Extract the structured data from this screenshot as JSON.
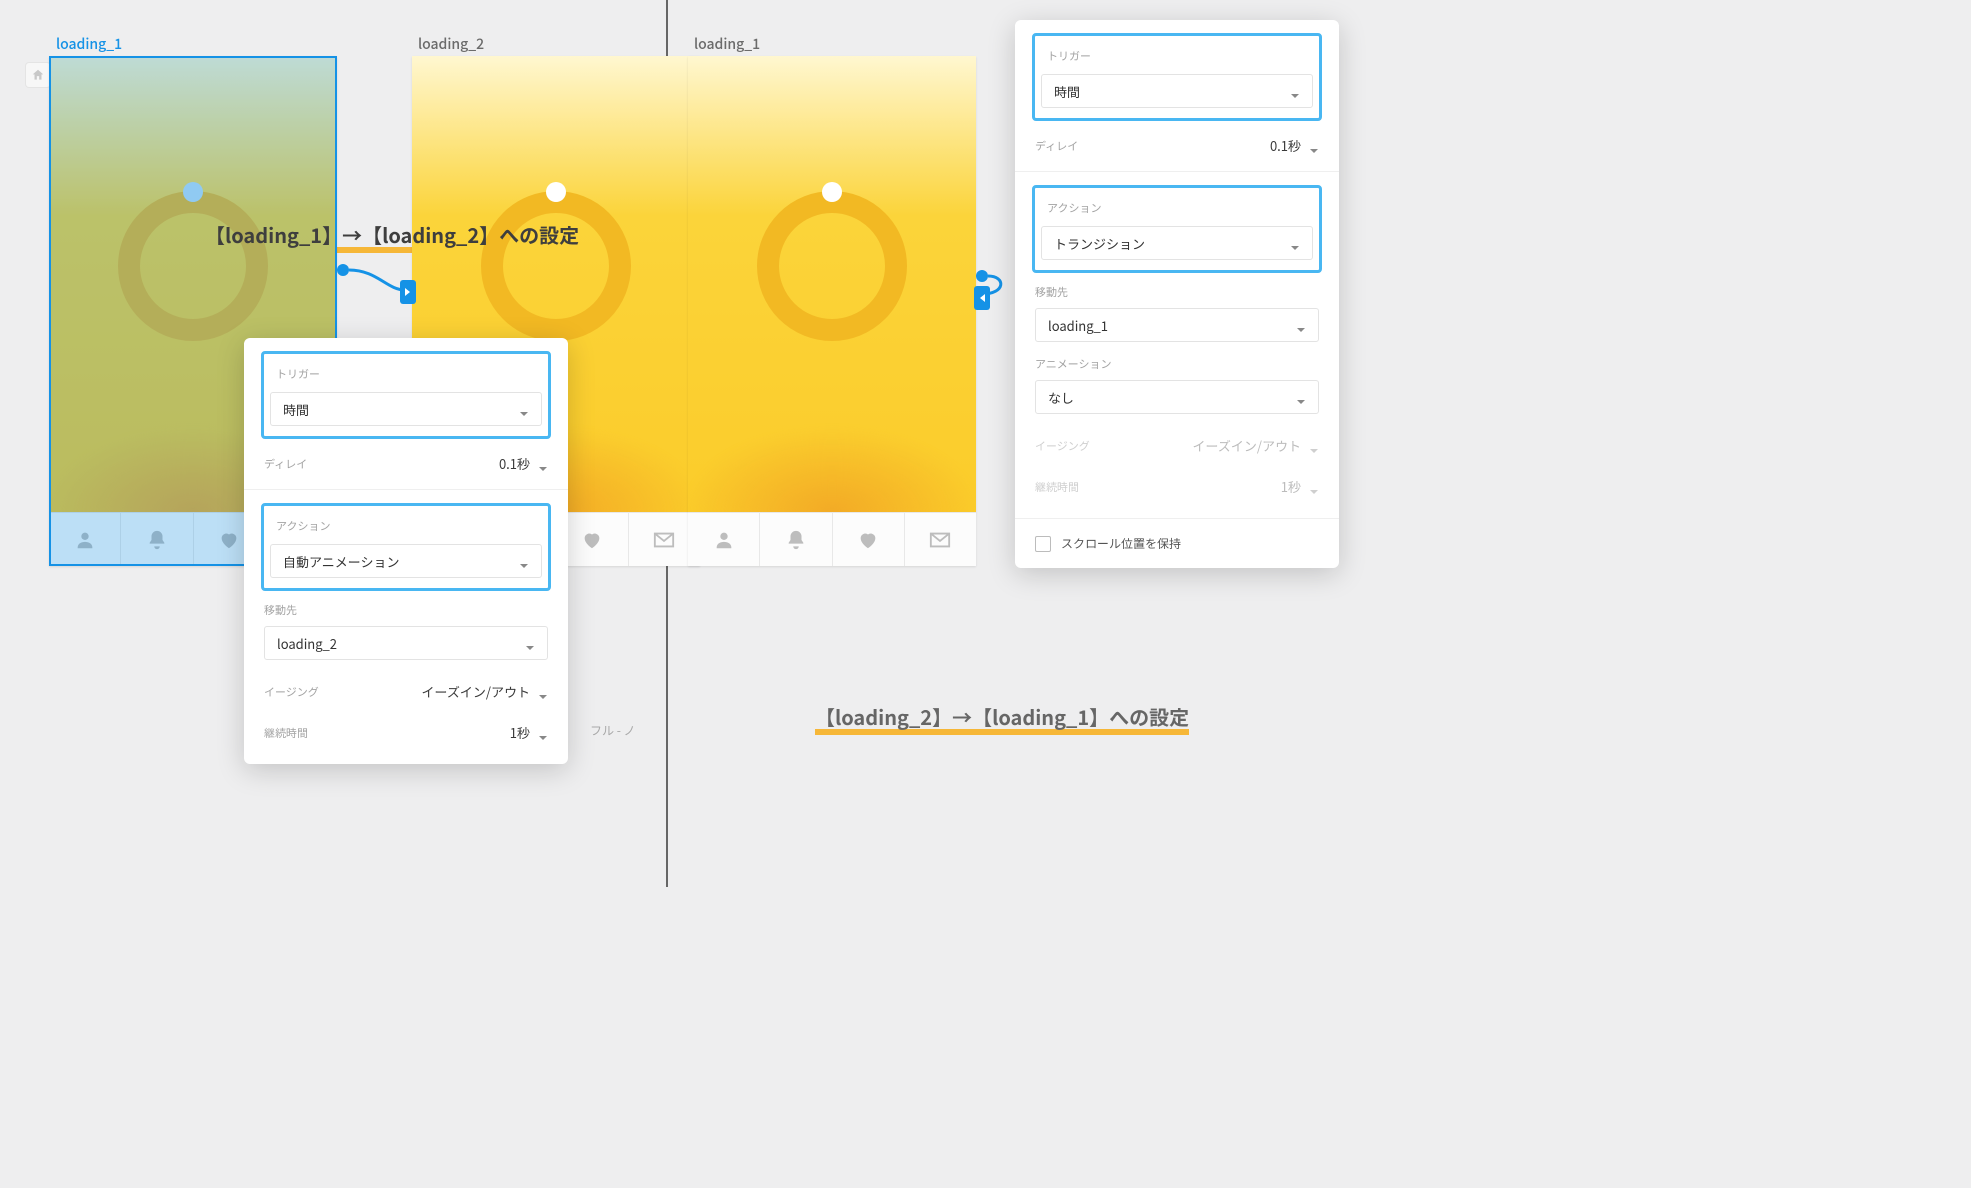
{
  "left": {
    "artboards": {
      "a1_label": "loading_1",
      "a2_label": "loading_2"
    },
    "callout": "【loading_1】→【loading_2】への設定",
    "panel": {
      "trigger_label": "トリガー",
      "trigger_value": "時間",
      "delay_label": "ディレイ",
      "delay_value": "0.1秒",
      "action_label": "アクション",
      "action_value": "自動アニメーション",
      "dest_label": "移動先",
      "dest_value": "loading_2",
      "easing_label": "イージング",
      "easing_value": "イーズイン/アウト",
      "duration_label": "継続時間",
      "duration_value": "1秒"
    }
  },
  "right": {
    "artboard_label": "loading_1",
    "callout": "【loading_2】→【loading_1】への設定",
    "panel": {
      "trigger_label": "トリガー",
      "trigger_value": "時間",
      "delay_label": "ディレイ",
      "delay_value": "0.1秒",
      "action_label": "アクション",
      "action_value": "トランジション",
      "dest_label": "移動先",
      "dest_value": "loading_1",
      "anim_label": "アニメーション",
      "anim_value": "なし",
      "easing_label": "イージング",
      "easing_value": "イーズイン/アウト",
      "duration_label": "継続時間",
      "duration_value": "1秒",
      "preserve_scroll_label": "スクロール位置を保持"
    }
  }
}
